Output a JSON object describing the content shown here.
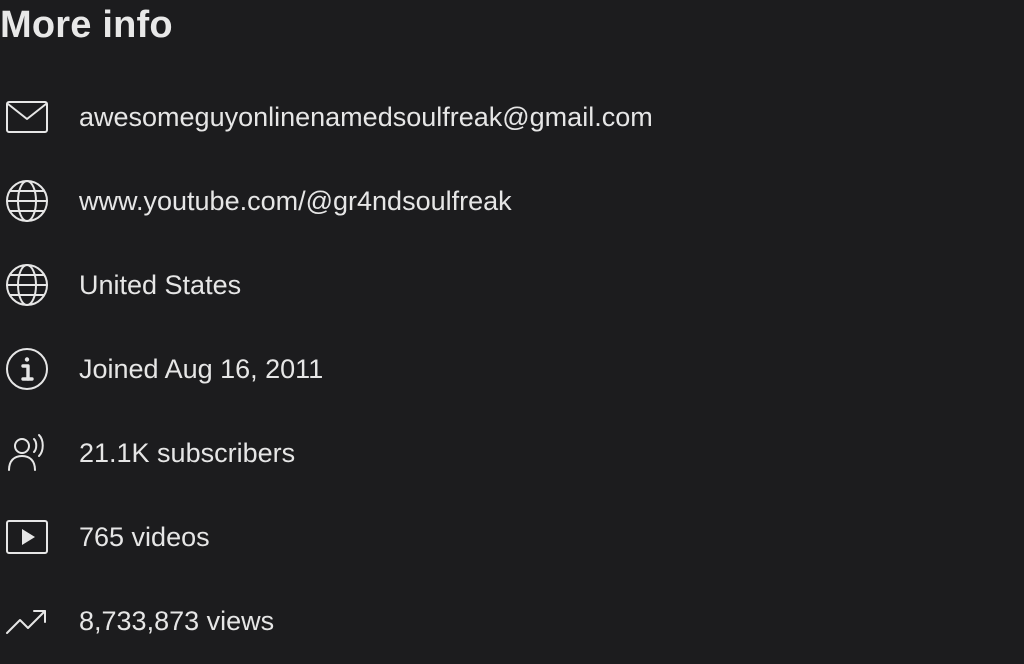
{
  "title": "More info",
  "items": [
    {
      "icon": "mail-icon",
      "text": "awesomeguyonlinenamedsoulfreak@gmail.com"
    },
    {
      "icon": "globe-icon",
      "text": "www.youtube.com/@gr4ndsoulfreak"
    },
    {
      "icon": "globe-icon",
      "text": "United States"
    },
    {
      "icon": "info-icon",
      "text": "Joined Aug 16, 2011"
    },
    {
      "icon": "subscribers-icon",
      "text": "21.1K subscribers"
    },
    {
      "icon": "video-play-icon",
      "text": "765 videos"
    },
    {
      "icon": "trending-up-icon",
      "text": "8,733,873 views"
    }
  ]
}
